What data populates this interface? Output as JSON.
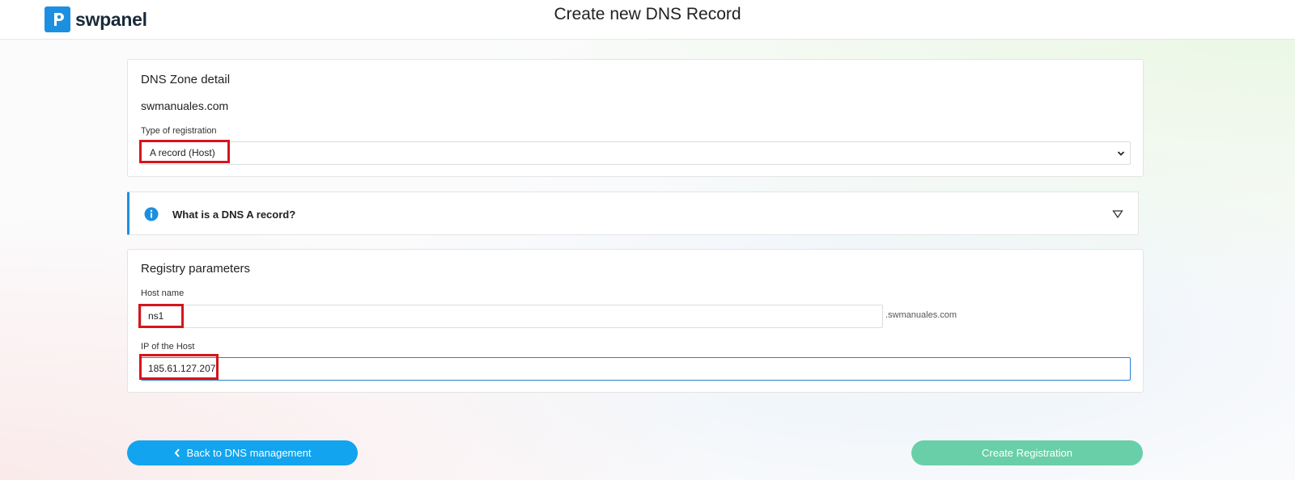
{
  "header": {
    "brand": "swpanel",
    "title": "Create new DNS Record",
    "brand_color": "#1d8fe0"
  },
  "zone_card": {
    "title": "DNS Zone detail",
    "zone_name": "swmanuales.com",
    "type_label": "Type of registration",
    "type_value": "A record (Host)"
  },
  "info": {
    "text": "What is a DNS A record?",
    "icon": "info-icon",
    "toggle_icon": "triangle-down-icon"
  },
  "params": {
    "title": "Registry parameters",
    "host_label": "Host name",
    "host_value": "ns1",
    "host_suffix": ".swmanuales.com",
    "ip_label": "IP of the Host",
    "ip_value": "185.61.127.207"
  },
  "actions": {
    "back_label": "Back to DNS management",
    "create_label": "Create Registration",
    "back_color": "#12a4ee",
    "create_color": "#68cfa9"
  }
}
